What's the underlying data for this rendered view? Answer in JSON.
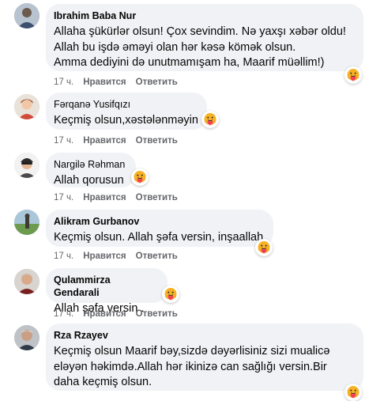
{
  "comments": [
    {
      "author": "Ibrahim Baba Nur",
      "lines": [
        "Allaha şükürlər olsun! Çox sevindim. Nə yaxşı xəbər oldu!",
        "Allah bu işdə əməyi olan hər kəsə kömək olsun.",
        "Amma dediyini də unutmamışam ha, Maarif müəllim!)"
      ],
      "time": "17 ч.",
      "like": "Нравится",
      "reply": "Ответить",
      "reaction": "care-emoji-icon"
    },
    {
      "author": "Fərqanə Yusifqızı",
      "lines": [
        "Keçmiş olsun,xəstələnməyin"
      ],
      "time": "17 ч.",
      "like": "Нравится",
      "reply": "Ответить",
      "reaction": "care-emoji-icon"
    },
    {
      "author": "Nargilə Rəhman",
      "lines": [
        "Allah qorusun"
      ],
      "time": "17 ч.",
      "like": "Нравится",
      "reply": "Ответить",
      "reaction": "care-emoji-icon"
    },
    {
      "author": "Alikram Gurbanov",
      "lines": [
        "Keçmiş olsun. Allah şəfa versin, inşaallah."
      ],
      "time": "17 ч.",
      "like": "Нравится",
      "reply": "Ответить",
      "reaction": "care-emoji-icon"
    },
    {
      "author": "Qulammirza Gendarali",
      "lines": [
        "Allah şəfa versin ."
      ],
      "time": "17 ч.",
      "like": "Нравится",
      "reply": "Ответить",
      "reaction": "care-emoji-icon"
    },
    {
      "author": "Rza Rzayev",
      "lines": [
        "Keçmiş olsun Maarif bəy,sizdə dəyərlisiniz sizi mualicə",
        "eləyən həkimdə.Allah hər ikinizə can sağlığı versin.Bir",
        "daha keçmiş olsun."
      ],
      "time": "",
      "like": "",
      "reply": "",
      "reaction": "care-emoji-icon"
    }
  ],
  "colors": {
    "bubble": "#f0f2f5",
    "text": "#050505",
    "meta": "#65676b",
    "emoji_face": "#f7b125",
    "emoji_heart": "#f33e58"
  }
}
